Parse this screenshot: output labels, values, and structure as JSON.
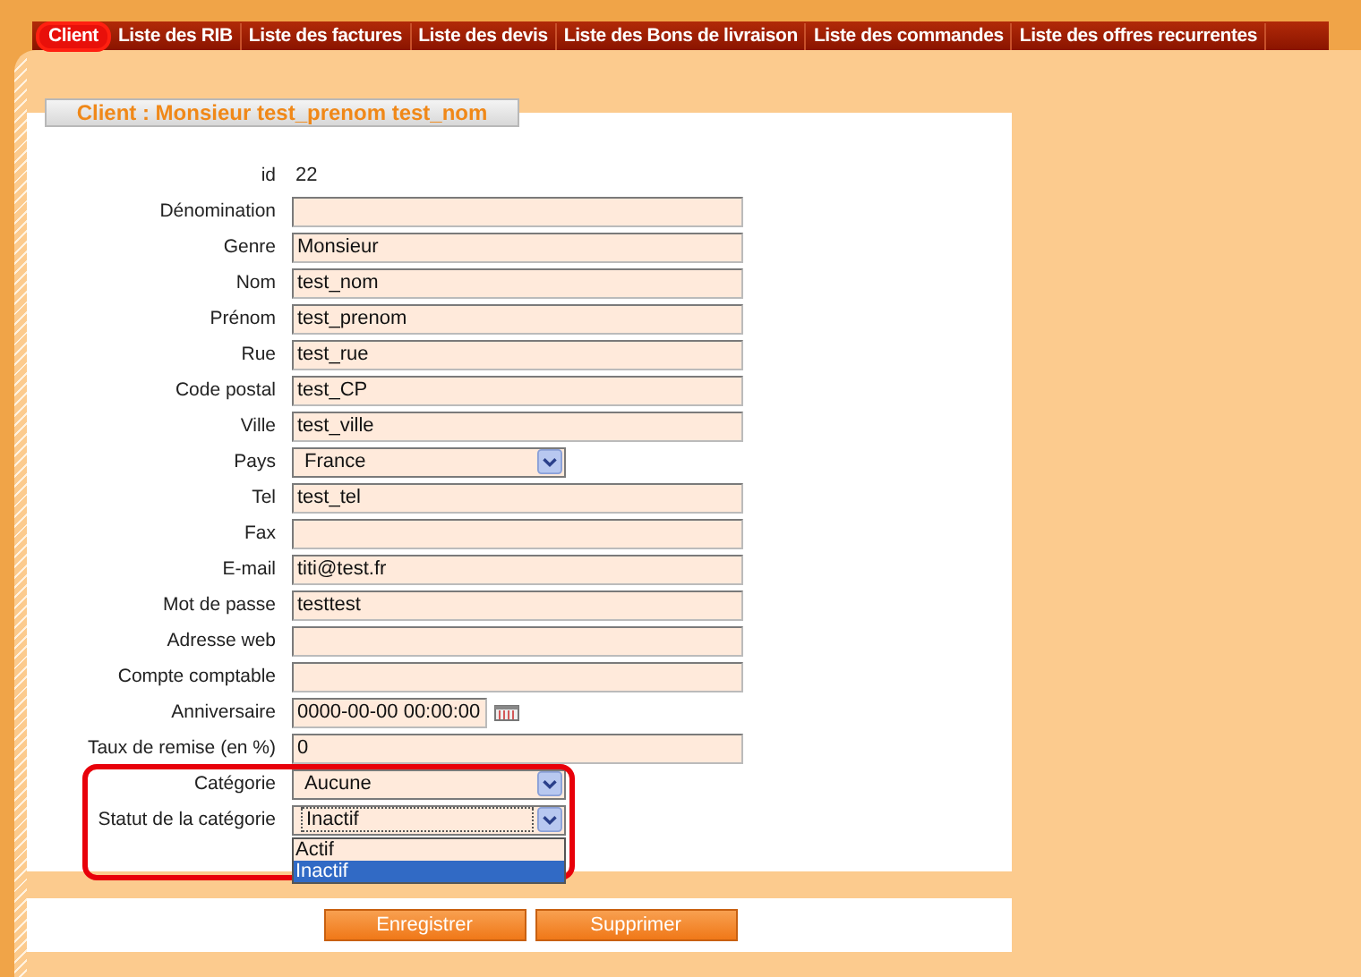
{
  "tabs": [
    {
      "label": "Client",
      "selected": true
    },
    {
      "label": "Liste des RIB",
      "selected": false
    },
    {
      "label": "Liste des factures",
      "selected": false
    },
    {
      "label": "Liste des devis",
      "selected": false
    },
    {
      "label": "Liste des Bons de livraison",
      "selected": false
    },
    {
      "label": "Liste des commandes",
      "selected": false
    },
    {
      "label": "Liste des offres recurrentes",
      "selected": false
    }
  ],
  "title": "Client : Monsieur test_prenom test_nom",
  "fields": [
    {
      "kind": "text",
      "label": "id",
      "value": "22"
    },
    {
      "kind": "input",
      "label": "Dénomination"
    },
    {
      "kind": "input",
      "label": "Genre",
      "value": "Monsieur"
    },
    {
      "kind": "input",
      "label": "Nom",
      "value": "test_nom"
    },
    {
      "kind": "input",
      "label": "Prénom",
      "value": "test_prenom"
    },
    {
      "kind": "input",
      "label": "Rue",
      "value": "test_rue"
    },
    {
      "kind": "input",
      "label": "Code postal",
      "value": "test_CP"
    },
    {
      "kind": "input",
      "label": "Ville",
      "value": "test_ville"
    },
    {
      "kind": "select",
      "label": "Pays",
      "value": "France"
    },
    {
      "kind": "input",
      "label": "Tel",
      "value": "test_tel"
    },
    {
      "kind": "input",
      "label": "Fax"
    },
    {
      "kind": "input",
      "label": "E-mail",
      "value": "titi@test.fr"
    },
    {
      "kind": "input",
      "label": "Mot de passe",
      "value": "testtest"
    },
    {
      "kind": "input",
      "label": "Adresse web"
    },
    {
      "kind": "input",
      "label": "Compte comptable"
    },
    {
      "kind": "date",
      "label": "Anniversaire",
      "value": "0000-00-00 00:00:00"
    },
    {
      "kind": "input",
      "label": "Taux de remise (en %)",
      "value": "0"
    }
  ],
  "highlighted_fields": [
    {
      "kind": "select",
      "label": "Catégorie",
      "value": "Aucune"
    },
    {
      "kind": "select",
      "label": "Statut de la catégorie",
      "value": "Inactif",
      "expanded": true,
      "options": [
        {
          "label": "Actif",
          "selected": false
        },
        {
          "label": "Inactif",
          "selected": true
        }
      ]
    }
  ],
  "buttons": [
    "Enregistrer",
    "Supprimer"
  ]
}
